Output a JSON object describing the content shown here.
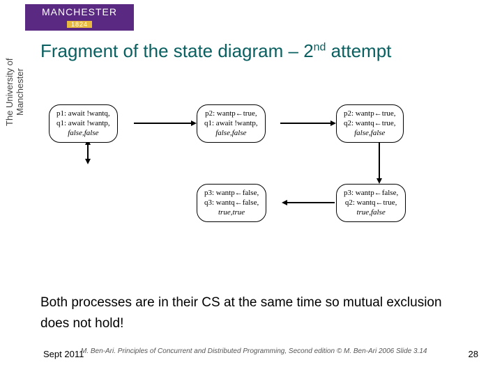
{
  "logo": {
    "name": "MANCHESTER",
    "year": "1824"
  },
  "side": "The University of Manchester",
  "title_prefix": "Fragment of the state diagram – 2",
  "title_sup": "nd",
  "title_suffix": " attempt",
  "nodes": {
    "n1": {
      "l1": "p1: await !wantq,",
      "l2": "q1: await !wantp,",
      "vals": "false,false"
    },
    "n2": {
      "l1": "p2: wantp←true,",
      "l2": "q1: await !wantp,",
      "vals": "false,false"
    },
    "n3": {
      "l1": "p2: wantp←true,",
      "l2": "q2: wantq←true,",
      "vals": "false,false"
    },
    "n4": {
      "l1": "p3: wantp←false,",
      "l2": "q3: wantq←false,",
      "vals": "true,true"
    },
    "n5": {
      "l1": "p3: wantp←false,",
      "l2": "q2: wantq←true,",
      "vals": "true,false"
    }
  },
  "conclusion": "Both processes are in their CS at the same time so mutual exclusion does not hold!",
  "credit": "M. Ben-Ari. Principles of Concurrent and Distributed Programming, Second edition © M. Ben-Ari 2006  Slide 3.14",
  "footer_date": "Sept 2011",
  "page": "28",
  "chart_data": {
    "type": "table",
    "description": "state transition diagram fragment",
    "states": [
      {
        "id": "s1",
        "p": "p1: await !wantq",
        "q": "q1: await !wantp",
        "wantp": false,
        "wantq": false
      },
      {
        "id": "s2",
        "p": "p2: wantp←true",
        "q": "q1: await !wantp",
        "wantp": false,
        "wantq": false
      },
      {
        "id": "s3",
        "p": "p2: wantp←true",
        "q": "q2: wantq←true",
        "wantp": false,
        "wantq": false
      },
      {
        "id": "s4",
        "p": "p3: wantp←false",
        "q": "q3: wantq←false",
        "wantp": true,
        "wantq": true
      },
      {
        "id": "s5",
        "p": "p3: wantp←false",
        "q": "q2: wantq←true",
        "wantp": true,
        "wantq": false
      }
    ],
    "transitions": [
      {
        "from": "start",
        "to": "s1"
      },
      {
        "from": "s1",
        "to": "s2"
      },
      {
        "from": "s2",
        "to": "s3"
      },
      {
        "from": "s3",
        "to": "s5"
      },
      {
        "from": "s5",
        "to": "s4"
      }
    ]
  }
}
